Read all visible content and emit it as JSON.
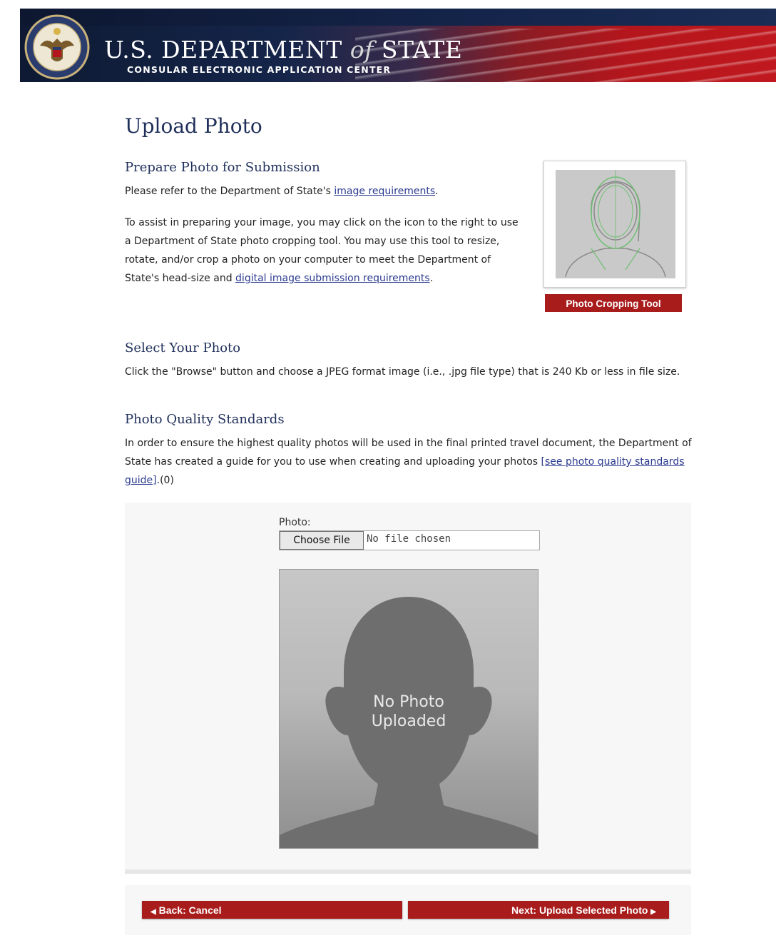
{
  "header": {
    "dept_name_part1": "U.S. DEPARTMENT",
    "dept_name_of": "of",
    "dept_name_part2": "STATE",
    "subtitle": "CONSULAR ELECTRONIC APPLICATION CENTER",
    "seal_icon": "great-seal-icon",
    "colors": {
      "navy": "#15254a",
      "red": "#b3161c"
    }
  },
  "page": {
    "title": "Upload Photo"
  },
  "prepare": {
    "heading": "Prepare Photo for Submission",
    "line1_pre": "Please refer to the Department of State's ",
    "line1_link": "image requirements",
    "line1_post": ".",
    "assist_text": "To assist in preparing your image, you may click on the icon to the right to use a Department of State photo cropping tool. You may use this tool to resize, rotate, and/or crop a photo on your computer to meet the Department of State's head-size and ",
    "assist_link": "digital image submission requirements",
    "assist_post": ".",
    "tool_button": "Photo Cropping Tool"
  },
  "select": {
    "heading": "Select Your Photo",
    "text": "Click the \"Browse\" button and choose a JPEG format image (i.e., .jpg file type) that is 240 Kb or less in file size."
  },
  "quality": {
    "heading": "Photo Quality Standards",
    "text": "In order to ensure the highest quality photos will be used in the final printed travel document, the Department of State has created a guide for you to use when creating and uploading your photos ",
    "link": "[see photo quality standards guide]",
    "post": ".(0)"
  },
  "upload": {
    "label": "Photo:",
    "choose_button": "Choose File",
    "file_status": "No file chosen",
    "placeholder_line1": "No Photo",
    "placeholder_line2": "Uploaded"
  },
  "nav": {
    "back_label": "Back: Cancel",
    "next_label": "Next: Upload Selected Photo",
    "accent": "#a81c1c"
  }
}
